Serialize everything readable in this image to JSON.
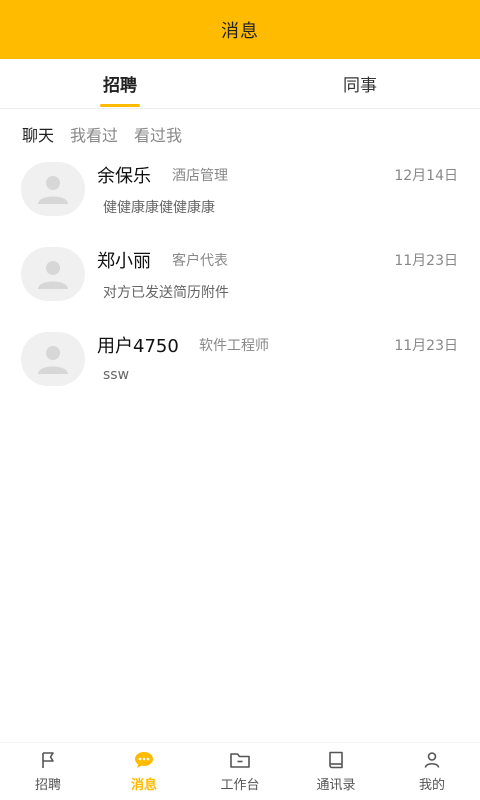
{
  "header": {
    "title": "消息"
  },
  "top_tabs": [
    {
      "label": "招聘",
      "active": true
    },
    {
      "label": "同事",
      "active": false
    }
  ],
  "sub_tabs": [
    {
      "label": "聊天",
      "active": true
    },
    {
      "label": "我看过",
      "active": false
    },
    {
      "label": "看过我",
      "active": false
    }
  ],
  "messages": [
    {
      "name": "余保乐",
      "role": "酒店管理",
      "date": "12月14日",
      "preview": "健健康康健健康康"
    },
    {
      "name": "郑小丽",
      "role": "客户代表",
      "date": "11月23日",
      "preview": "对方已发送简历附件"
    },
    {
      "name": "用户4750",
      "role": "软件工程师",
      "date": "11月23日",
      "preview": "ssw"
    }
  ],
  "tabbar": [
    {
      "label": "招聘",
      "icon": "flag-icon",
      "active": false
    },
    {
      "label": "消息",
      "icon": "chat-bubble-icon",
      "active": true
    },
    {
      "label": "工作台",
      "icon": "folder-icon",
      "active": false
    },
    {
      "label": "通讯录",
      "icon": "book-icon",
      "active": false
    },
    {
      "label": "我的",
      "icon": "person-icon",
      "active": false
    }
  ],
  "colors": {
    "accent": "#FFBB00",
    "text": "#222222",
    "muted": "#888888",
    "avatar_bg": "#f0f0f0"
  }
}
